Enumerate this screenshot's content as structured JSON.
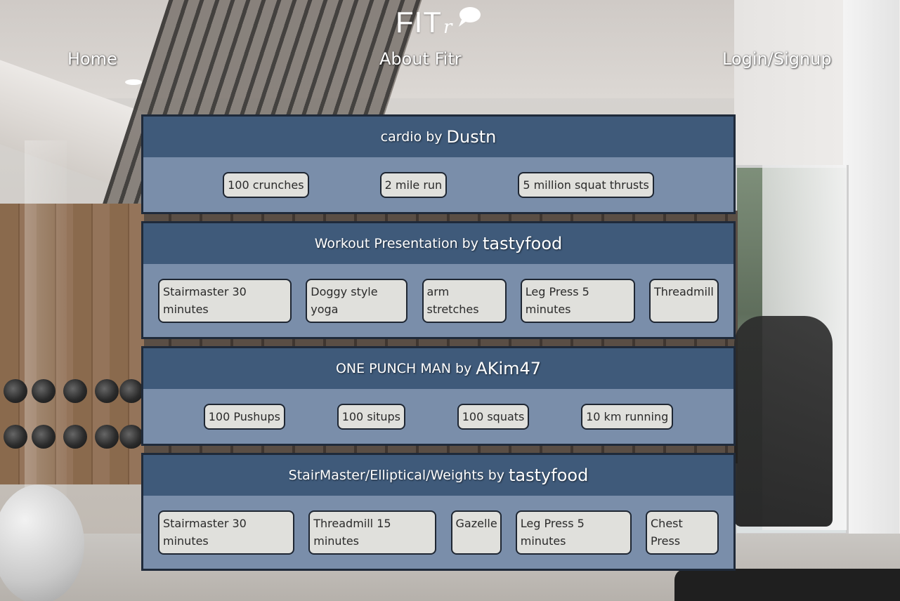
{
  "brand": {
    "logo_main": "FIT",
    "logo_r": "r"
  },
  "nav": {
    "home": "Home",
    "about": "About Fitr",
    "login": "Login/Signup"
  },
  "workouts": [
    {
      "name": "cardio",
      "by": "by",
      "user": "Dustn",
      "exercises": [
        "100 crunches",
        "2 mile run",
        "5 million squat thrusts"
      ]
    },
    {
      "name": "Workout Presentation",
      "by": "by",
      "user": "tastyfood",
      "exercises": [
        "Stairmaster 30 minutes",
        "Doggy style yoga",
        "arm stretches",
        "Leg Press 5 minutes",
        "Threadmill"
      ]
    },
    {
      "name": "ONE PUNCH MAN",
      "by": "by",
      "user": "AKim47",
      "exercises": [
        "100 Pushups",
        "100 situps",
        "100 squats",
        "10 km running"
      ]
    },
    {
      "name": "StairMaster/Elliptical/Weights",
      "by": "by",
      "user": "tastyfood",
      "exercises": [
        "Stairmaster 30 minutes",
        "Threadmill 15 minutes",
        "Gazelle",
        "Leg Press 5 minutes",
        "Chest Press"
      ]
    }
  ],
  "colors": {
    "card_header": "#3f5a7a",
    "card_body": "#7a8eaa",
    "exercise_chip": "#e0e0dc",
    "card_border": "#1f2a3a"
  }
}
